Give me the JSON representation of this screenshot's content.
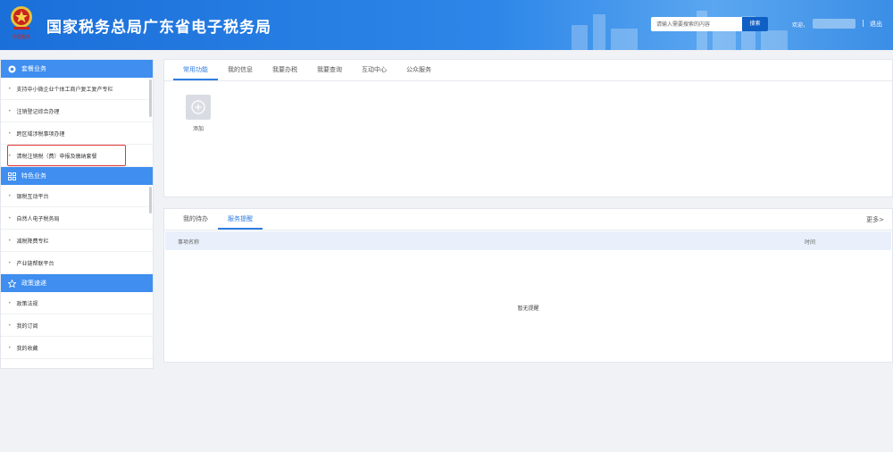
{
  "header": {
    "emblem_caption": "中国税务",
    "title": "国家税务总局广东省电子税务局",
    "search": {
      "placeholder": "请输入需要搜索的内容",
      "button_label": "搜索"
    },
    "welcome_label": "欢迎，",
    "separator": "|",
    "logout_label": "退出"
  },
  "sidebar": {
    "sections": [
      {
        "title": "套餐业务",
        "icon": "package-icon",
        "items": [
          "支持中小微企业个体工商户复工复产专栏",
          "注销登记综合办理",
          "跨区域涉税事项办理",
          "清税注销税（费）申报及缴纳套餐"
        ]
      },
      {
        "title": "特色业务",
        "icon": "grid-icon",
        "items": [
          "银税互动平台",
          "自然人电子税务局",
          "减税降费专栏",
          "产业链帮联平台"
        ]
      },
      {
        "title": "政策速递",
        "icon": "star-icon",
        "items": [
          "政策法规",
          "我的订阅",
          "我的收藏"
        ]
      }
    ],
    "highlight_color": "#e23535"
  },
  "main": {
    "function_tabs": [
      "常用功能",
      "我的信息",
      "我要办税",
      "我要查询",
      "互动中心",
      "公众服务"
    ],
    "active_function_tab": "常用功能",
    "add_label": "添加",
    "todo_tabs": [
      "我的待办",
      "服务提醒"
    ],
    "active_todo_tab": "服务提醒",
    "more_label": "更多>",
    "table_headers": [
      "事项名称",
      "时间"
    ],
    "empty_text": "暂无提醒"
  },
  "colors": {
    "brand_blue": "#2d86e8",
    "accent": "#3f8ef0",
    "active_tab": "#2f7de1"
  }
}
